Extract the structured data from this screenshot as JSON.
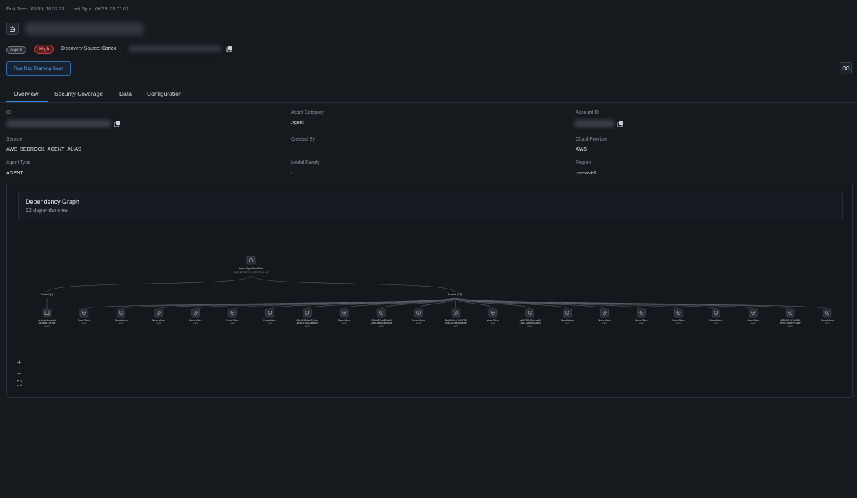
{
  "header": {
    "first_seen": "First Seen: 06/05, 10:32:23",
    "last_sync": "Last Sync: 06/29, 05:01:07",
    "tag_type": "Agent",
    "tag_risk": "High",
    "discovery_label": "Discovery Source:",
    "discovery_value": "Cortex",
    "run_button": "Run Red Teaming Scan"
  },
  "tabs": [
    "Overview",
    "Security Coverage",
    "Data",
    "Configuration"
  ],
  "info": {
    "id_label": "ID",
    "asset_category_label": "Asset Category",
    "asset_category": "Agent",
    "account_id_label": "Account ID",
    "service_label": "Service",
    "service": "AWS_BEDROCK_AGENT_ALIAS",
    "created_by_label": "Created By",
    "created_by": "-",
    "cloud_provider_label": "Cloud Provider",
    "cloud_provider": "AWS",
    "agent_type_label": "Agent Type",
    "agent_type": "AGENT",
    "model_family_label": "Model Family",
    "model_family": "-",
    "region_label": "Region",
    "region": "us-east-1"
  },
  "graph": {
    "title": "Dependency Graph",
    "subtitle": "22 dependencies",
    "root_name": "demo-AgentToolAlias",
    "root_type": "AWS_BEDROCK_AGENT_ALIAS",
    "dataset_group": "Dataset (1)",
    "models_group": "Models (21)",
    "nodes": [
      {
        "name": "bedrock-knowledge-base-r1e1sw",
        "sub": "AWS",
        "kind": "dataset"
      },
      {
        "name": "Nova Micro",
        "sub": "AWS",
        "kind": "model"
      },
      {
        "name": "Nova Micro",
        "sub": "AWS",
        "kind": "model"
      },
      {
        "name": "Nova Micro",
        "sub": "AWS",
        "kind": "model"
      },
      {
        "name": "Nova Micro",
        "sub": "AWS",
        "kind": "model"
      },
      {
        "name": "Nova Micro",
        "sub": "AWS",
        "kind": "model"
      },
      {
        "name": "Nova Micro",
        "sub": "AWS",
        "kind": "model"
      },
      {
        "name": "45c9fe56-4a25-f1aa-a169-970d1a6f5595",
        "sub": "AWS",
        "kind": "model"
      },
      {
        "name": "Nova Micro",
        "sub": "AWS",
        "kind": "model"
      },
      {
        "name": "f2f5ad87-ea68-4af0-1ab9-a0b19ab4b29c",
        "sub": "AWS",
        "kind": "model"
      },
      {
        "name": "Nova Micro",
        "sub": "AWS",
        "kind": "model"
      },
      {
        "name": "32a0424e-b7f4-1755-9f56-c1b4e05da99e",
        "sub": "AWS",
        "kind": "model"
      },
      {
        "name": "Nova Micro",
        "sub": "AWS",
        "kind": "model"
      },
      {
        "name": "ca2072f9-f5eb-4a40-b651-a8f9d0c0f843",
        "sub": "AWS",
        "kind": "model"
      },
      {
        "name": "Nova Micro",
        "sub": "AWS",
        "kind": "model"
      },
      {
        "name": "Nova Micro",
        "sub": "AWS",
        "kind": "model"
      },
      {
        "name": "Nova Micro",
        "sub": "AWS",
        "kind": "model"
      },
      {
        "name": "Nova Micro",
        "sub": "AWS",
        "kind": "model"
      },
      {
        "name": "Nova Micro",
        "sub": "AWS",
        "kind": "model"
      },
      {
        "name": "Nova Micro",
        "sub": "AWS",
        "kind": "model"
      },
      {
        "name": "bf233059-17d4-f152-e992-93eb7f734f40",
        "sub": "AWS",
        "kind": "model"
      },
      {
        "name": "Nova Micro",
        "sub": "AWS",
        "kind": "model"
      }
    ],
    "zoom_in": "+",
    "zoom_out": "−",
    "fit": "⛶"
  }
}
